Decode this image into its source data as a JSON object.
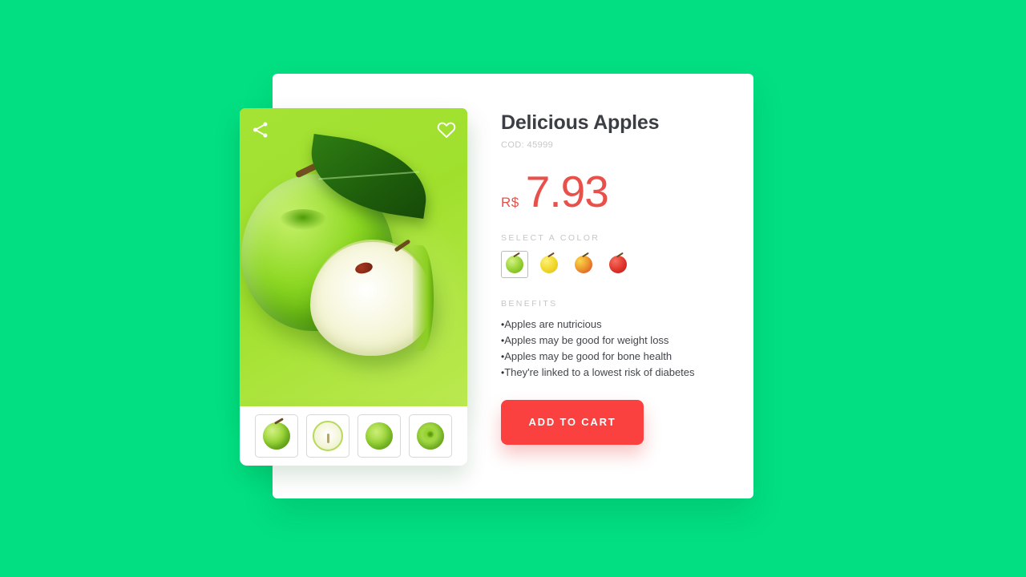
{
  "theme": {
    "page_background": "#02df82",
    "card_background": "#ffffff",
    "accent_price": "#e8504a",
    "accent_button": "#fb4040",
    "title_color": "#3b3f43",
    "muted_label": "#c4c6c8"
  },
  "media": {
    "share_icon": "share-icon",
    "favorite_icon": "heart-icon",
    "hero_alt": "green-apple-with-leaf-and-slice",
    "thumbnails": [
      {
        "name": "thumb-whole-apple",
        "style": "whole"
      },
      {
        "name": "thumb-half-apple",
        "style": "half"
      },
      {
        "name": "thumb-round-apple",
        "style": "round"
      },
      {
        "name": "thumb-top-apple",
        "style": "top"
      }
    ]
  },
  "product": {
    "title": "Delicious Apples",
    "code": "COD: 45999",
    "currency": "R$",
    "price": "7.93",
    "color_label": "SELECT A COLOR",
    "colors": [
      {
        "name": "color-green",
        "style": "green",
        "selected": true
      },
      {
        "name": "color-yellow",
        "style": "yellow",
        "selected": false
      },
      {
        "name": "color-mixed",
        "style": "mixed",
        "selected": false
      },
      {
        "name": "color-red",
        "style": "red",
        "selected": false
      }
    ],
    "benefits_label": "BENEFITS",
    "benefits": [
      "Apples are nutricious",
      "Apples may be good for weight loss",
      "Apples may be good for bone health",
      "They're linked to a lowest risk of diabetes"
    ],
    "cta_label": "ADD TO CART"
  }
}
